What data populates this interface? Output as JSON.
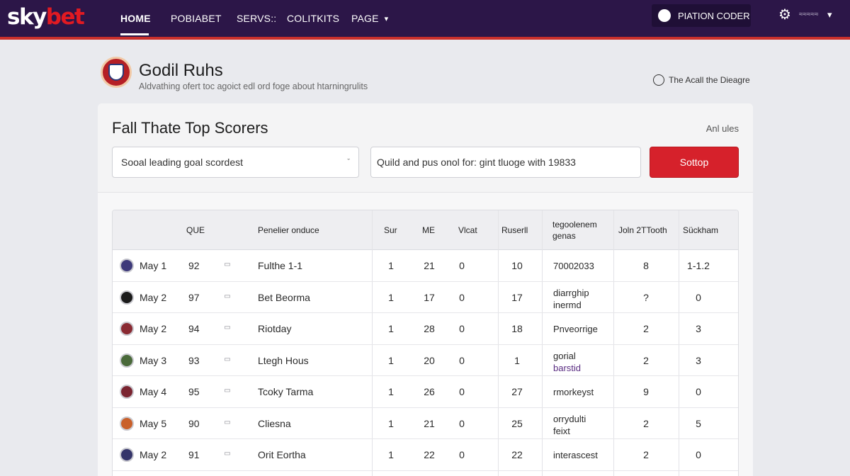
{
  "brand": {
    "sky": "sky",
    "bet": "bet"
  },
  "nav": {
    "home": "HOME",
    "item2": "POBIABET",
    "item3": "SERVS::",
    "item4": "COLITKITS",
    "item5": "PAGE",
    "caret": "▾"
  },
  "account": {
    "label": "PIATION CODER",
    "gear": "⚙",
    "user": "≈≈≈≈≈",
    "caret": "▾"
  },
  "header": {
    "title": "Godil Ruhs",
    "subtitle": "Aldvathing ofert toc agoict edl ord foge about htarningrulits",
    "help_label": "The Acall the Dieagre"
  },
  "card": {
    "title": "Fall Thate Top Scorers",
    "aside": "Anl ules",
    "select_value": "Sooal leading goal scordest",
    "select_caret": "ˇ",
    "search_placeholder": "Quild and pus onol for: gint tluoge with 19833",
    "button_label": "Sottop"
  },
  "table": {
    "columns": {
      "c1": "QUE",
      "c2": "Penelier onduce",
      "c3": "Sur",
      "c4": "ME",
      "c5": "Vlcat",
      "c6": "Ruserll",
      "c7": "tegoolenem genas",
      "c8": "Joln 2TTooth",
      "c9": "Sückham"
    },
    "rows": [
      {
        "date": "May 1",
        "que": "92",
        "name": "Fulthe 1-1",
        "sur": "1",
        "me": "21",
        "vlcat": "0",
        "ruserll": "10",
        "genas": "70002033",
        "genas2": "",
        "joln": "8",
        "suckham": "1-1.2",
        "badge_color": "#3e3a7a"
      },
      {
        "date": "May 2",
        "que": "97",
        "name": "Bet Beorma",
        "sur": "1",
        "me": "17",
        "vlcat": "0",
        "ruserll": "17",
        "genas": "diarrghip",
        "genas2": "inermd",
        "joln": "?",
        "suckham": "0",
        "badge_color": "#1b1b1b"
      },
      {
        "date": "May 2",
        "que": "94",
        "name": "Riotday",
        "sur": "1",
        "me": "28",
        "vlcat": "0",
        "ruserll": "18",
        "genas": "Pnveorrige",
        "genas2": "",
        "joln": "2",
        "suckham": "3",
        "badge_color": "#8a2a32"
      },
      {
        "date": "May 3",
        "que": "93",
        "name": "Ltegh Hous",
        "sur": "1",
        "me": "20",
        "vlcat": "0",
        "ruserll": "1",
        "genas": "gorial",
        "genas2": "barstid",
        "joln": "2",
        "suckham": "3",
        "badge_color": "#4a6a3a"
      },
      {
        "date": "May 4",
        "que": "95",
        "name": "Tcoky Tarma",
        "sur": "1",
        "me": "26",
        "vlcat": "0",
        "ruserll": "27",
        "genas": "rmorkeyst",
        "genas2": "",
        "joln": "9",
        "suckham": "0",
        "badge_color": "#7a2430"
      },
      {
        "date": "May 5",
        "que": "90",
        "name": "Cliesna",
        "sur": "1",
        "me": "21",
        "vlcat": "0",
        "ruserll": "25",
        "genas": "orrydulti",
        "genas2": "feixt",
        "joln": "2",
        "suckham": "5",
        "badge_color": "#c9602a"
      },
      {
        "date": "May 2",
        "que": "91",
        "name": "Orit Eortha",
        "sur": "1",
        "me": "22",
        "vlcat": "0",
        "ruserll": "22",
        "genas": "interascest",
        "genas2": "",
        "joln": "2",
        "suckham": "0",
        "badge_color": "#35356a"
      }
    ]
  },
  "colors": {
    "nav_bg": "#2c1648",
    "accent_red": "#d6212b",
    "page_bg": "#e9eaee"
  }
}
